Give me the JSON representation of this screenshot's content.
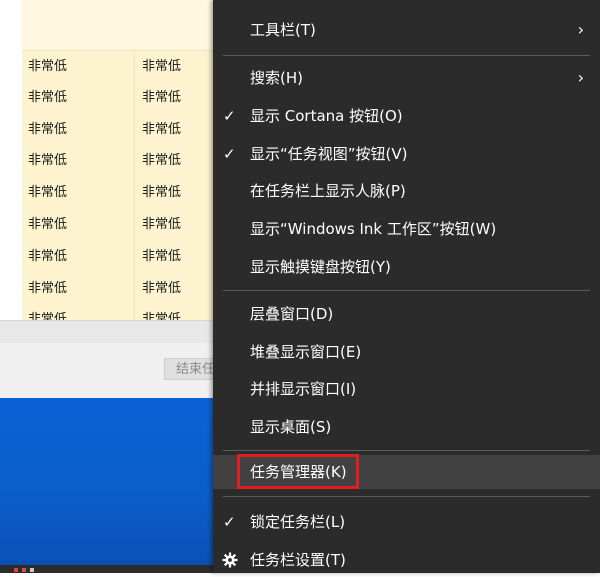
{
  "table": {
    "rows": [
      [
        "非常低",
        "非常低"
      ],
      [
        "非常低",
        "非常低"
      ],
      [
        "非常低",
        "非常低"
      ],
      [
        "非常低",
        "非常低"
      ],
      [
        "非常低",
        "非常低"
      ],
      [
        "非常低",
        "非常低"
      ],
      [
        "非常低",
        "非常低"
      ],
      [
        "非常低",
        "非常低"
      ],
      [
        "非常低",
        "非常低"
      ]
    ]
  },
  "footer": {
    "end_task_label": "结束任务"
  },
  "menu": {
    "items": [
      {
        "label": "工具栏(T)",
        "checked": false,
        "submenu": true
      },
      {
        "label": "搜索(H)",
        "checked": false,
        "submenu": true
      },
      {
        "label": "显示 Cortana 按钮(O)",
        "checked": true,
        "submenu": false
      },
      {
        "label": "显示“任务视图”按钮(V)",
        "checked": true,
        "submenu": false
      },
      {
        "label": "在任务栏上显示人脉(P)",
        "checked": false,
        "submenu": false
      },
      {
        "label": "显示“Windows Ink 工作区”按钮(W)",
        "checked": false,
        "submenu": false
      },
      {
        "label": "显示触摸键盘按钮(Y)",
        "checked": false,
        "submenu": false
      },
      {
        "label": "层叠窗口(D)",
        "checked": false,
        "submenu": false
      },
      {
        "label": "堆叠显示窗口(E)",
        "checked": false,
        "submenu": false
      },
      {
        "label": "并排显示窗口(I)",
        "checked": false,
        "submenu": false
      },
      {
        "label": "显示桌面(S)",
        "checked": false,
        "submenu": false
      },
      {
        "label": "任务管理器(K)",
        "checked": false,
        "submenu": false,
        "hover": true
      },
      {
        "label": "锁定任务栏(L)",
        "checked": true,
        "submenu": false
      },
      {
        "label": "任务栏设置(T)",
        "checked": false,
        "submenu": false,
        "icon": "gear-icon"
      }
    ],
    "check_glyph": "✓",
    "arrow_glyph": "›",
    "highlight_color": "#e02020",
    "menu_bg": "#2b2b2b"
  }
}
